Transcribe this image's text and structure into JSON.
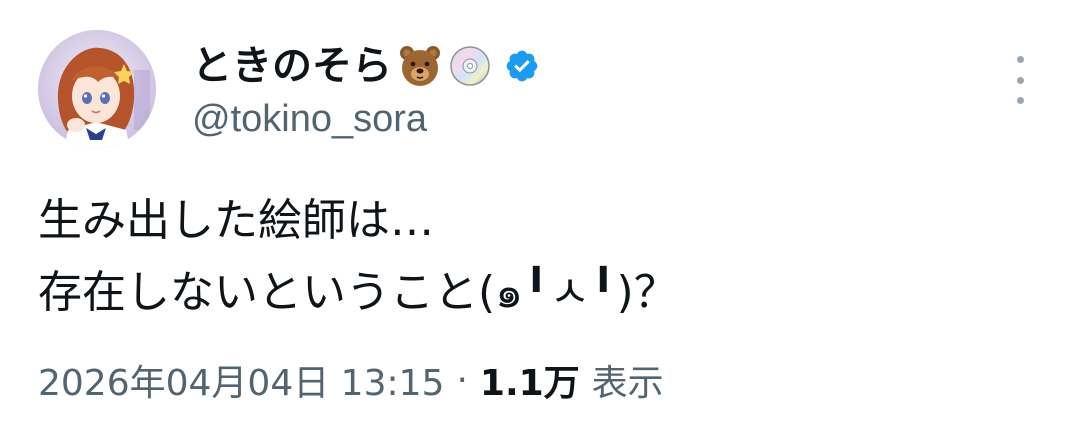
{
  "author": {
    "display_name": "ときのそら",
    "name_emojis": [
      "bear-emoji",
      "disc-emoji"
    ],
    "verified": true,
    "handle": "@tokino_sora"
  },
  "tweet": {
    "lines": [
      "生み出した絵師は…",
      "存在しないということ(๑╹ㅅ╹)？"
    ]
  },
  "meta": {
    "timestamp": "2026年04月04日 13:15",
    "separator": "·",
    "views_count": "1.1万",
    "views_label": "表示"
  },
  "colors": {
    "text_primary": "#0f1419",
    "text_secondary": "#536471",
    "verified_blue": "#1d9bf0",
    "more_dots": "#9aa6b0"
  }
}
